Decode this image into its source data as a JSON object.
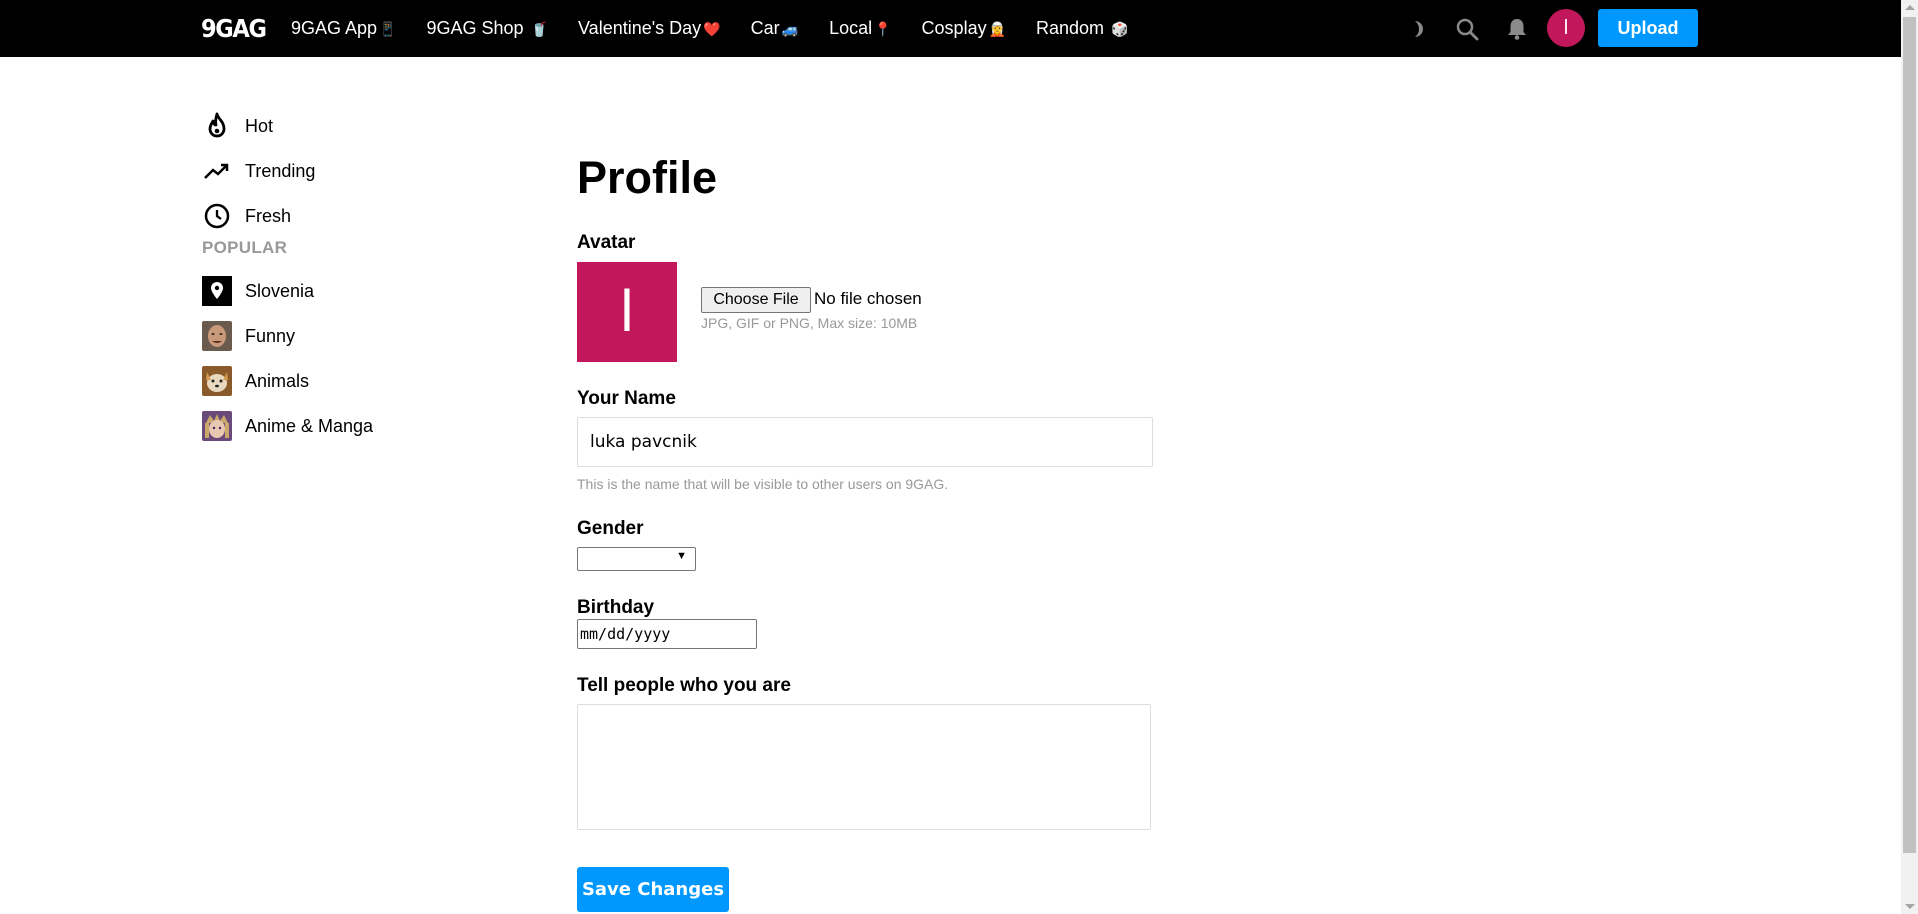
{
  "header": {
    "logo": "9GAG",
    "nav": [
      {
        "label": "9GAG App",
        "emoji": "📱"
      },
      {
        "label": "9GAG Shop",
        "emoji": "🥤"
      },
      {
        "label": "Valentine's Day",
        "emoji": "❤️"
      },
      {
        "label": "Car",
        "emoji": "🚙"
      },
      {
        "label": "Local",
        "emoji": "📍"
      },
      {
        "label": "Cosplay",
        "emoji": "🧝"
      },
      {
        "label": "Random",
        "emoji": "🎲"
      }
    ],
    "avatar_letter": "l",
    "upload_label": "Upload"
  },
  "sidebar": {
    "items": [
      {
        "label": "Hot",
        "icon": "fire-icon"
      },
      {
        "label": "Trending",
        "icon": "trending-icon"
      },
      {
        "label": "Fresh",
        "icon": "clock-icon"
      }
    ],
    "popular_heading": "POPULAR",
    "popular": [
      {
        "label": "Slovenia",
        "icon": "location-icon"
      },
      {
        "label": "Funny"
      },
      {
        "label": "Animals"
      },
      {
        "label": "Anime & Manga"
      }
    ]
  },
  "profile": {
    "title": "Profile",
    "avatar_label": "Avatar",
    "avatar_letter": "l",
    "choose_file_label": "Choose File",
    "file_status": "No file chosen",
    "file_hint": "JPG, GIF or PNG, Max size: 10MB",
    "name_label": "Your Name",
    "name_value": "luka pavcnik",
    "name_hint": "This is the name that will be visible to other users on 9GAG.",
    "gender_label": "Gender",
    "gender_value": "",
    "birthday_label": "Birthday",
    "birthday_placeholder": "mm/dd/yyyy",
    "about_label": "Tell people who you are",
    "about_value": "",
    "save_label": "Save Changes"
  },
  "colors": {
    "accent": "#0098ff",
    "avatar_bg": "#c2185b",
    "topbar_bg": "#000000",
    "hint_text": "#999999"
  }
}
